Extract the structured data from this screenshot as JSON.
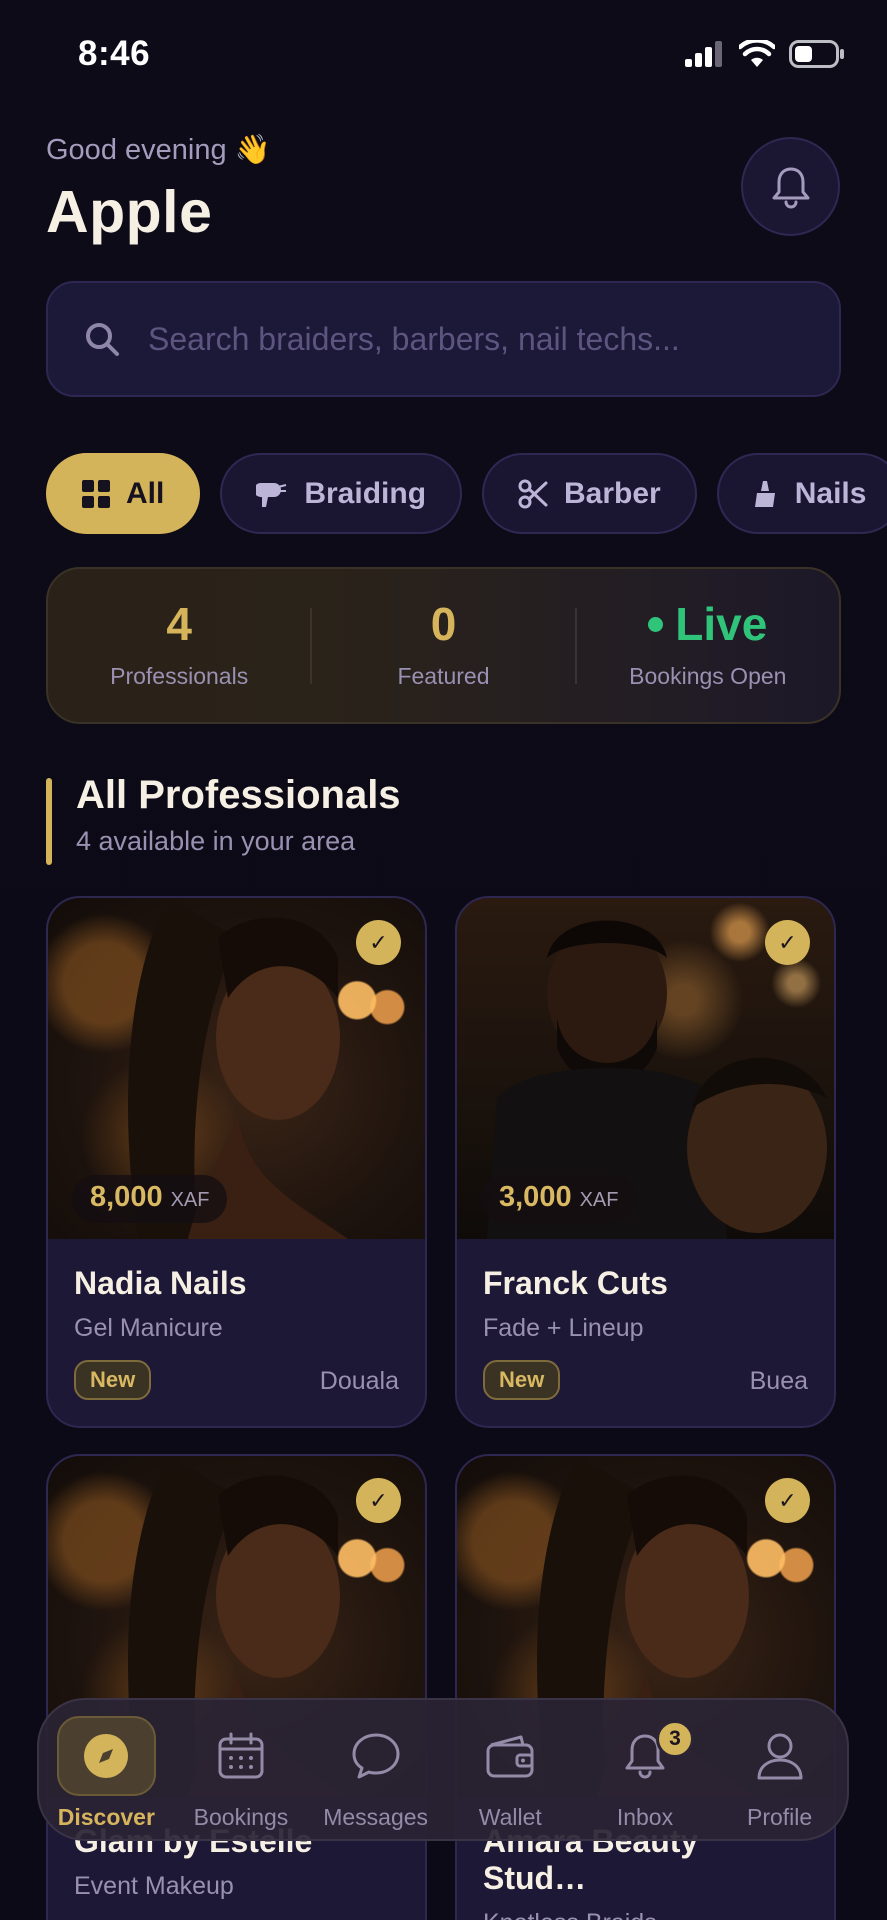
{
  "status_bar": {
    "time": "8:46"
  },
  "header": {
    "greeting": "Good evening 👋",
    "username": "Apple"
  },
  "search": {
    "placeholder": "Search braiders, barbers, nail techs..."
  },
  "categories": [
    {
      "label": "All",
      "icon": "grid-icon",
      "active": true
    },
    {
      "label": "Braiding",
      "icon": "hairdryer-icon",
      "active": false
    },
    {
      "label": "Barber",
      "icon": "scissors-icon",
      "active": false
    },
    {
      "label": "Nails",
      "icon": "nail-polish-icon",
      "active": false
    }
  ],
  "stats": [
    {
      "value": "4",
      "label": "Professionals"
    },
    {
      "value": "0",
      "label": "Featured"
    },
    {
      "value": "Live",
      "label": "Bookings Open"
    }
  ],
  "section": {
    "title": "All Professionals",
    "subtitle": "4 available in your area"
  },
  "professionals": [
    {
      "name": "Nadia Nails",
      "service": "Gel Manicure",
      "price": "8,000",
      "currency": "XAF",
      "badge": "New",
      "city": "Douala",
      "verified": "✓"
    },
    {
      "name": "Franck Cuts",
      "service": "Fade + Lineup",
      "price": "3,000",
      "currency": "XAF",
      "badge": "New",
      "city": "Buea",
      "verified": "✓"
    },
    {
      "name": "Glam by Estelle",
      "service": "Event Makeup",
      "verified": "✓"
    },
    {
      "name": "Amara Beauty Stud…",
      "service": "Knotless Braids",
      "verified": "✓"
    }
  ],
  "tabbar": [
    {
      "label": "Discover",
      "icon": "compass-icon",
      "active": true
    },
    {
      "label": "Bookings",
      "icon": "calendar-icon"
    },
    {
      "label": "Messages",
      "icon": "chat-bubble-icon"
    },
    {
      "label": "Wallet",
      "icon": "wallet-icon"
    },
    {
      "label": "Inbox",
      "icon": "bell-icon",
      "badge": "3"
    },
    {
      "label": "Profile",
      "icon": "person-icon"
    }
  ],
  "colors": {
    "accent": "#d4b45a",
    "live": "#2fc47a",
    "background": "#0c0a16",
    "card": "#1d1836"
  }
}
